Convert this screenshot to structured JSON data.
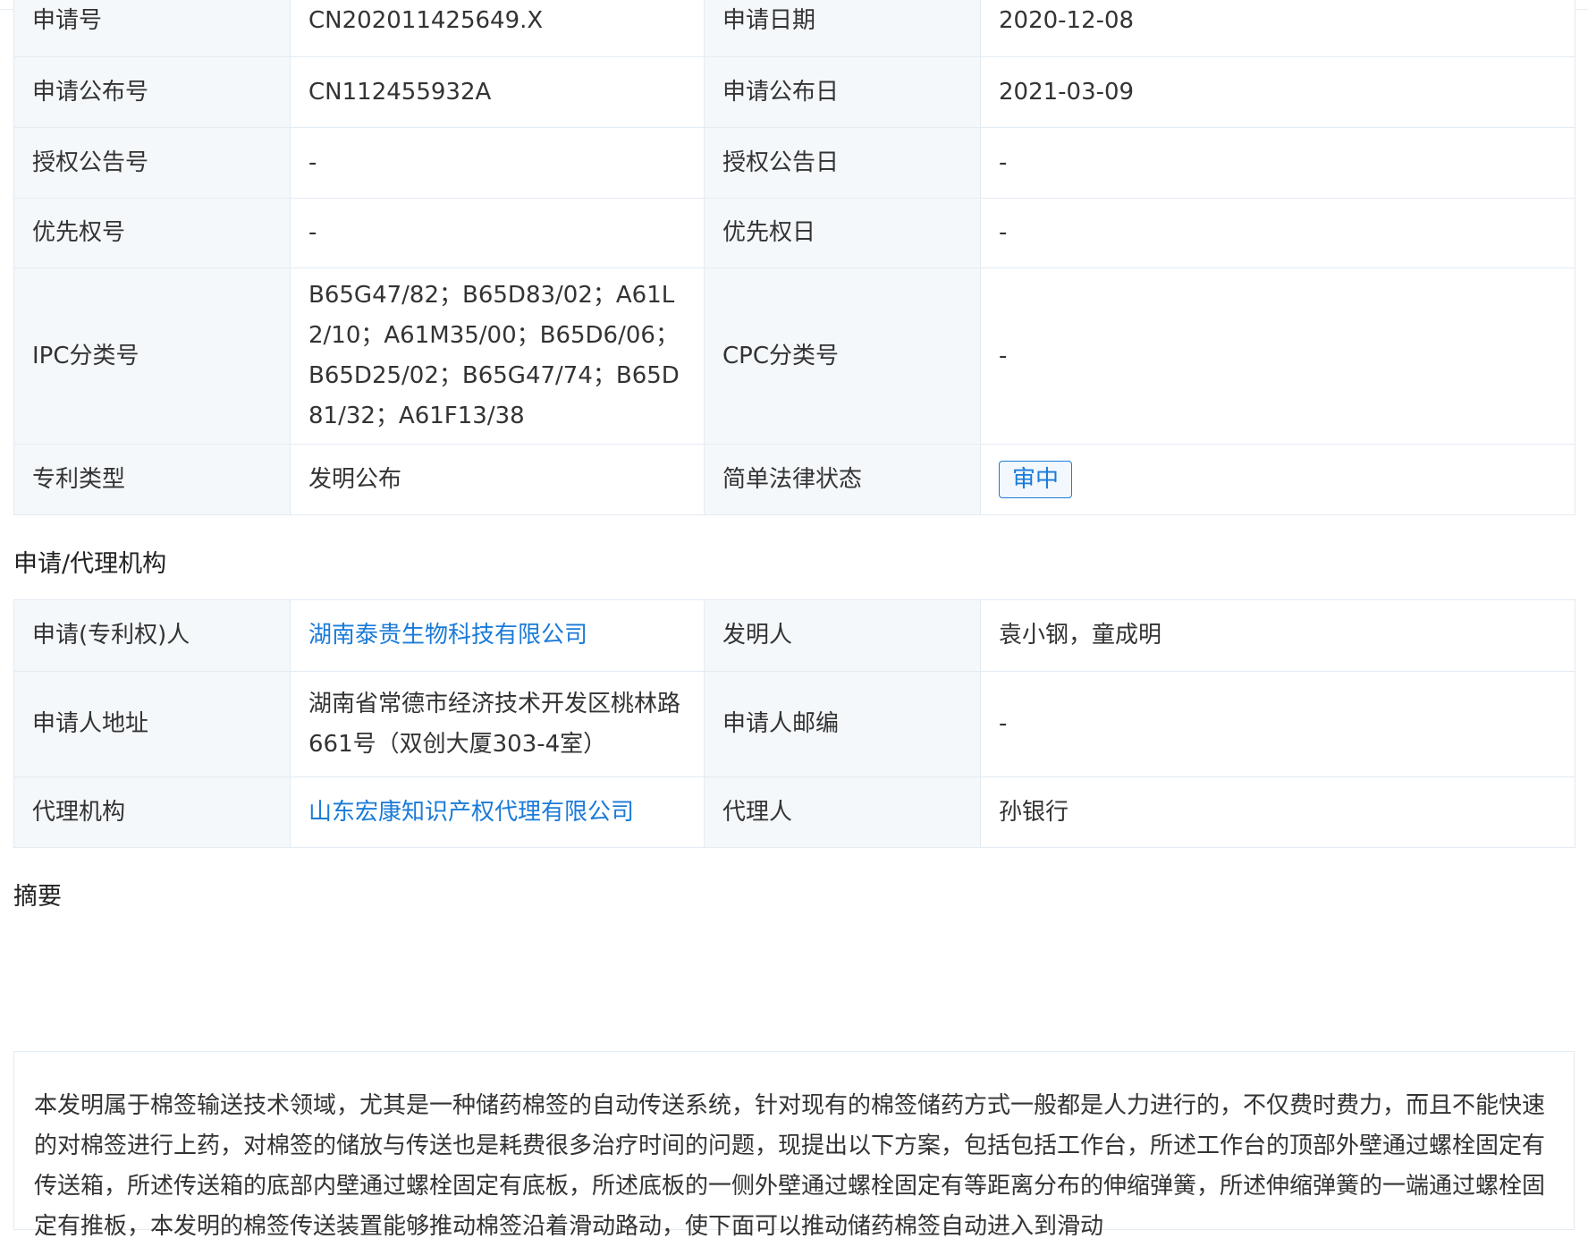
{
  "basic": {
    "app_no_label": "申请号",
    "app_no": "CN202011425649.X",
    "app_date_label": "申请日期",
    "app_date": "2020-12-08",
    "pub_no_label": "申请公布号",
    "pub_no": "CN112455932A",
    "pub_date_label": "申请公布日",
    "pub_date": "2021-03-09",
    "grant_no_label": "授权公告号",
    "grant_no": "-",
    "grant_date_label": "授权公告日",
    "grant_date": "-",
    "priority_no_label": "优先权号",
    "priority_no": "-",
    "priority_date_label": "优先权日",
    "priority_date": "-",
    "ipc_label": "IPC分类号",
    "ipc": "B65G47/82；B65D83/02；A61L2/10；A61M35/00；B65D6/06；B65D25/02；B65G47/74；B65D81/32；A61F13/38",
    "cpc_label": "CPC分类号",
    "cpc": "-",
    "type_label": "专利类型",
    "type": "发明公布",
    "legal_label": "简单法律状态",
    "legal_status": "审中"
  },
  "agency": {
    "section_title": "申请/代理机构",
    "applicant_label": "申请(专利权)人",
    "applicant": "湖南泰贵生物科技有限公司",
    "inventor_label": "发明人",
    "inventor": "袁小钢，童成明",
    "address_label": "申请人地址",
    "address": "湖南省常德市经济技术开发区桃林路661号（双创大厦303-4室）",
    "zip_label": "申请人邮编",
    "zip": "-",
    "agency_label": "代理机构",
    "agency": "山东宏康知识产权代理有限公司",
    "agent_label": "代理人",
    "agent": "孙银行"
  },
  "abstract": {
    "section_title": "摘要",
    "text": "本发明属于棉签输送技术领域，尤其是一种储药棉签的自动传送系统，针对现有的棉签储药方式一般都是人力进行的，不仅费时费力，而且不能快速的对棉签进行上药，对棉签的储放与传送也是耗费很多治疗时间的问题，现提出以下方案，包括包括工作台，所述工作台的顶部外壁通过螺栓固定有传送箱，所述传送箱的底部内壁通过螺栓固定有底板，所述底板的一侧外壁通过螺栓固定有等距离分布的伸缩弹簧，所述伸缩弹簧的一端通过螺栓固定有推板，本发明的棉签传送装置能够推动棉签沿着滑动路动，使下面可以推动储药棉签自动进入到滑动"
  },
  "colors": {
    "link": "#1a7bd8",
    "label_bg": "#f4f8fb",
    "border": "#e3ebf3"
  }
}
